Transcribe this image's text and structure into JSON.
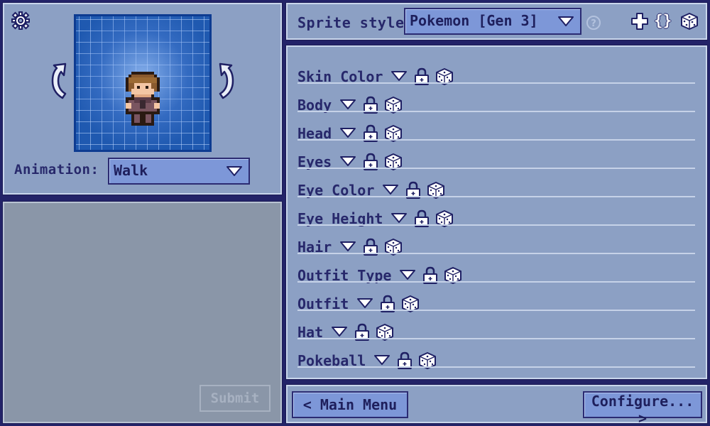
{
  "preview": {
    "animation_label": "Animation:",
    "animation_value": "Walk",
    "icons": {
      "settings": "gear-icon",
      "rotate_left": "rotate-left-arrow-icon",
      "rotate_right": "rotate-right-arrow-icon"
    }
  },
  "output": {
    "submit_label": "Submit"
  },
  "style_bar": {
    "label": "Sprite style:",
    "selected_style": "Pokemon [Gen 3]",
    "help_glyph": "?",
    "code_glyph": "{}",
    "icons": [
      "plus-icon",
      "code-braces-icon",
      "dice-icon"
    ]
  },
  "layers": [
    {
      "label": "Skin Color"
    },
    {
      "label": "Body"
    },
    {
      "label": "Head"
    },
    {
      "label": "Eyes"
    },
    {
      "label": "Eye Color"
    },
    {
      "label": "Eye Height"
    },
    {
      "label": "Hair"
    },
    {
      "label": "Outfit Type"
    },
    {
      "label": "Outfit"
    },
    {
      "label": "Hat"
    },
    {
      "label": "Pokeball"
    }
  ],
  "footer": {
    "main_menu_label": "< Main Menu",
    "configure_label": "Configure... >"
  },
  "colors": {
    "background": "#232368",
    "panel": "#8ca0c4",
    "grid": "#1f59b0",
    "text": "#27286b",
    "button": "#7d97d8"
  }
}
